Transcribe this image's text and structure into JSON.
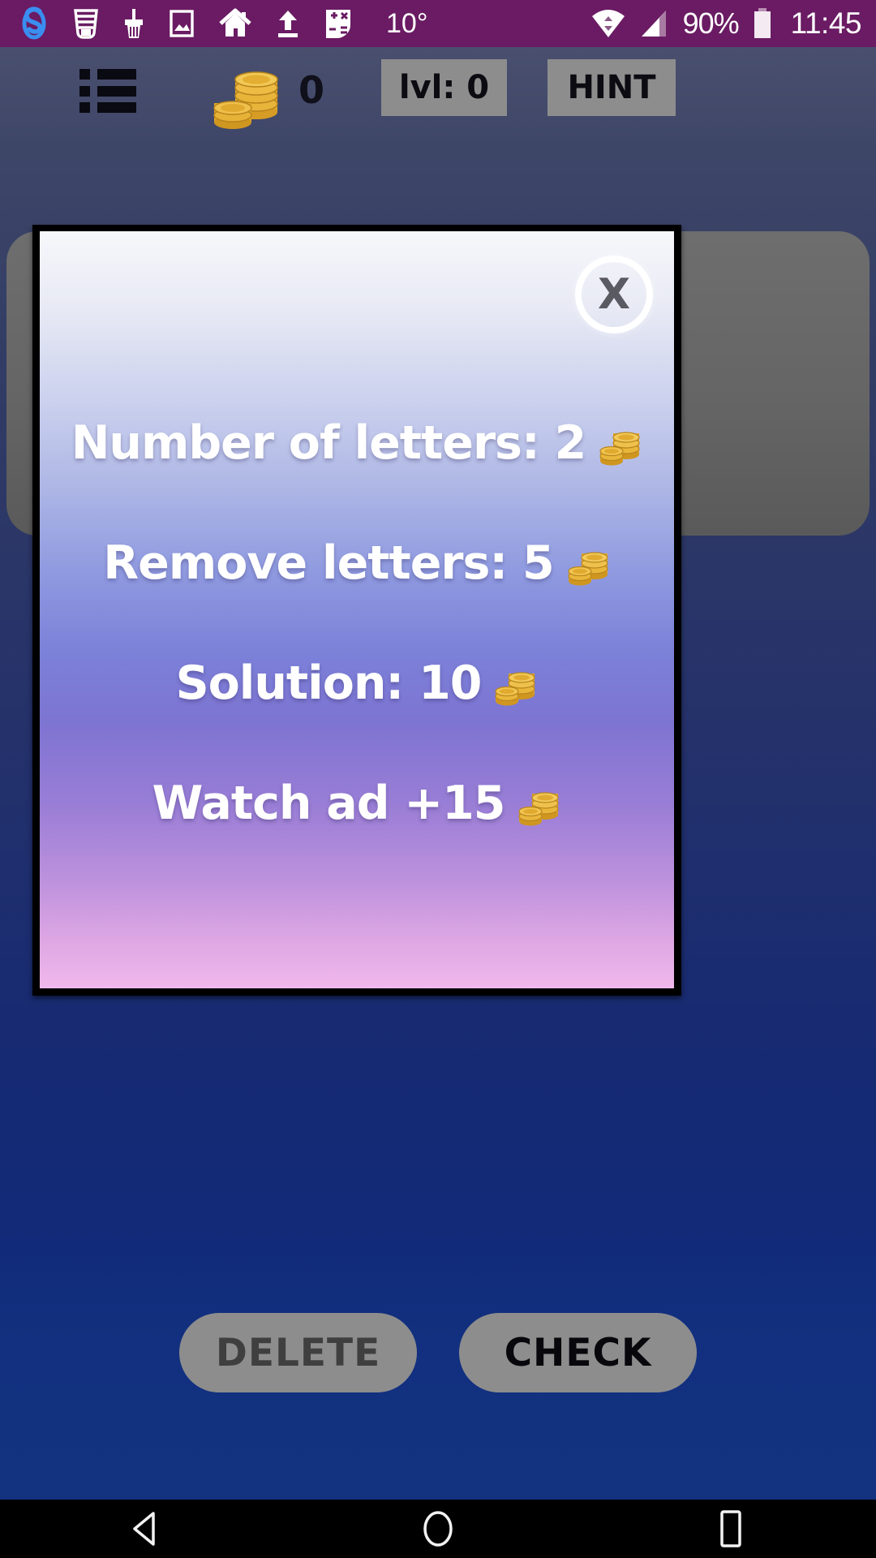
{
  "status_bar": {
    "background_color": "#6a1b63",
    "left_icons": [
      {
        "name": "s-logo-icon",
        "label": "S"
      },
      {
        "name": "inbox-icon",
        "label": "inbox"
      },
      {
        "name": "brush-icon",
        "label": "brush"
      },
      {
        "name": "photo-icon",
        "label": "photo"
      },
      {
        "name": "home-icon",
        "label": "home"
      },
      {
        "name": "upload-icon",
        "label": "upload"
      },
      {
        "name": "calculator-icon",
        "label": "calculator"
      }
    ],
    "temperature": "10°",
    "wifi": "wifi-icon",
    "signal": "signal-icon",
    "battery_percent": "90%",
    "battery": "battery-icon",
    "clock": "11:45"
  },
  "app_header": {
    "menu_icon": "list-menu-icon",
    "coin_icon": "coin-stack-icon",
    "coin_count": "0",
    "level_label": "lvl: 0",
    "hint_label": "HINT",
    "button_color": "#8d8d8d"
  },
  "dialog": {
    "close_label": "X",
    "border_color": "#000000",
    "gradient_start": "#f7f8fb",
    "gradient_mid": "#7b80d8",
    "gradient_end": "#f0b8ec",
    "options": [
      {
        "id": "number-of-letters",
        "label": "Number of letters: 2",
        "cost": "2",
        "icon": "coin-stack-icon"
      },
      {
        "id": "remove-letters",
        "label": "Remove letters: 5",
        "cost": "5",
        "icon": "coin-stack-icon"
      },
      {
        "id": "solution",
        "label": "Solution: 10",
        "cost": "10",
        "icon": "coin-stack-icon"
      },
      {
        "id": "watch-ad",
        "label": "Watch ad +15",
        "cost": "+15",
        "icon": "coin-stack-icon"
      }
    ]
  },
  "actions": {
    "delete_label": "DELETE",
    "check_label": "CHECK"
  },
  "nav_bar": {
    "back": "back-triangle-icon",
    "home": "home-circle-icon",
    "recents": "recents-square-icon"
  }
}
